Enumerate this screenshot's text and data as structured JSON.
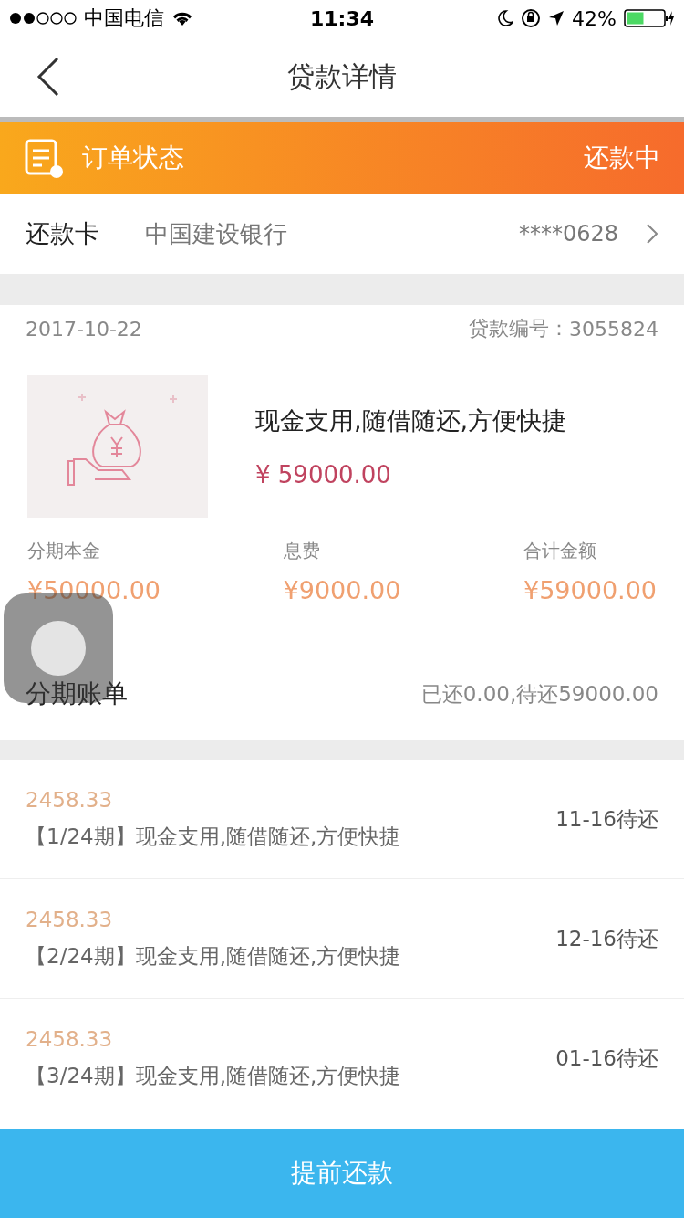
{
  "status_bar": {
    "carrier": "中国电信",
    "time": "11:34",
    "battery": "42%"
  },
  "nav": {
    "title": "贷款详情"
  },
  "order_status": {
    "label": "订单状态",
    "value": "还款中"
  },
  "card": {
    "label": "还款卡",
    "bank": "中国建设银行",
    "number": "****0628"
  },
  "loan": {
    "date": "2017-10-22",
    "loan_no_label": "贷款编号：",
    "loan_no": "3055824",
    "title": "现金支用,随借随还,方便快捷",
    "amount": "¥ 59000.00",
    "breakdown": [
      {
        "label": "分期本金",
        "value": "¥50000.00"
      },
      {
        "label": "息费",
        "value": "¥9000.00"
      },
      {
        "label": "合计金额",
        "value": "¥59000.00"
      }
    ]
  },
  "bills": {
    "title": "分期账单",
    "summary": "已还0.00,待还59000.00",
    "items": [
      {
        "amount": "2458.33",
        "desc": "【1/24期】现金支用,随借随还,方便快捷",
        "status": "11-16待还"
      },
      {
        "amount": "2458.33",
        "desc": "【2/24期】现金支用,随借随还,方便快捷",
        "status": "12-16待还"
      },
      {
        "amount": "2458.33",
        "desc": "【3/24期】现金支用,随借随还,方便快捷",
        "status": "01-16待还"
      }
    ]
  },
  "footer_button": "提前还款"
}
